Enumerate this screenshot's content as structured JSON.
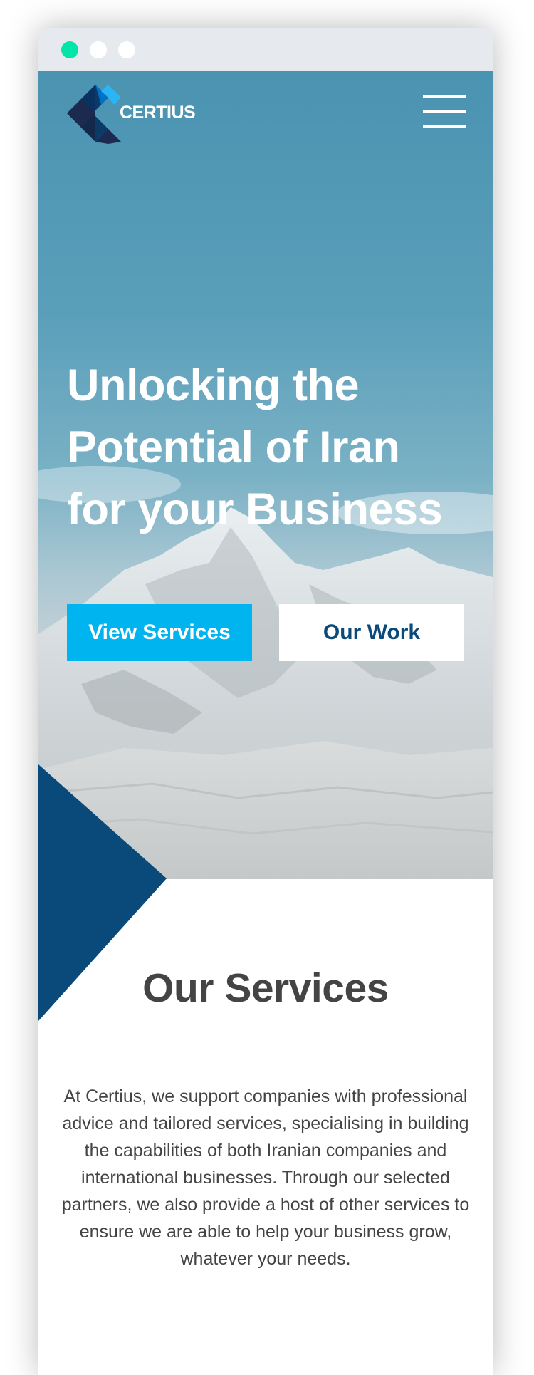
{
  "window": {
    "controls": [
      {
        "name": "window-dot-active",
        "color": "#00e6a8"
      },
      {
        "name": "window-dot",
        "color": "#ffffff"
      },
      {
        "name": "window-dot",
        "color": "#ffffff"
      }
    ]
  },
  "header": {
    "logo_text": "CERTIUS",
    "logo_colors": [
      "#0b3a66",
      "#1b2a4e",
      "#0071c5",
      "#29b6f6"
    ],
    "menu_icon": "hamburger-menu-icon"
  },
  "hero": {
    "title_lines": [
      "Unlocking the",
      "Potential of Iran",
      "for your Business"
    ],
    "primary_button": "View Services",
    "secondary_button": "Our Work",
    "primary_color": "#00b4f0",
    "secondary_text_color": "#0a4a7a"
  },
  "services": {
    "title": "Our Services",
    "body": "At Certius, we support companies with professional advice and tailored services, specialising in building the capabilities of both Iranian companies and international businesses. Through our selected partners, we also provide a host of other services to ensure we are able to help your business grow, whatever your needs.",
    "accent_color": "#0a4a7a"
  }
}
